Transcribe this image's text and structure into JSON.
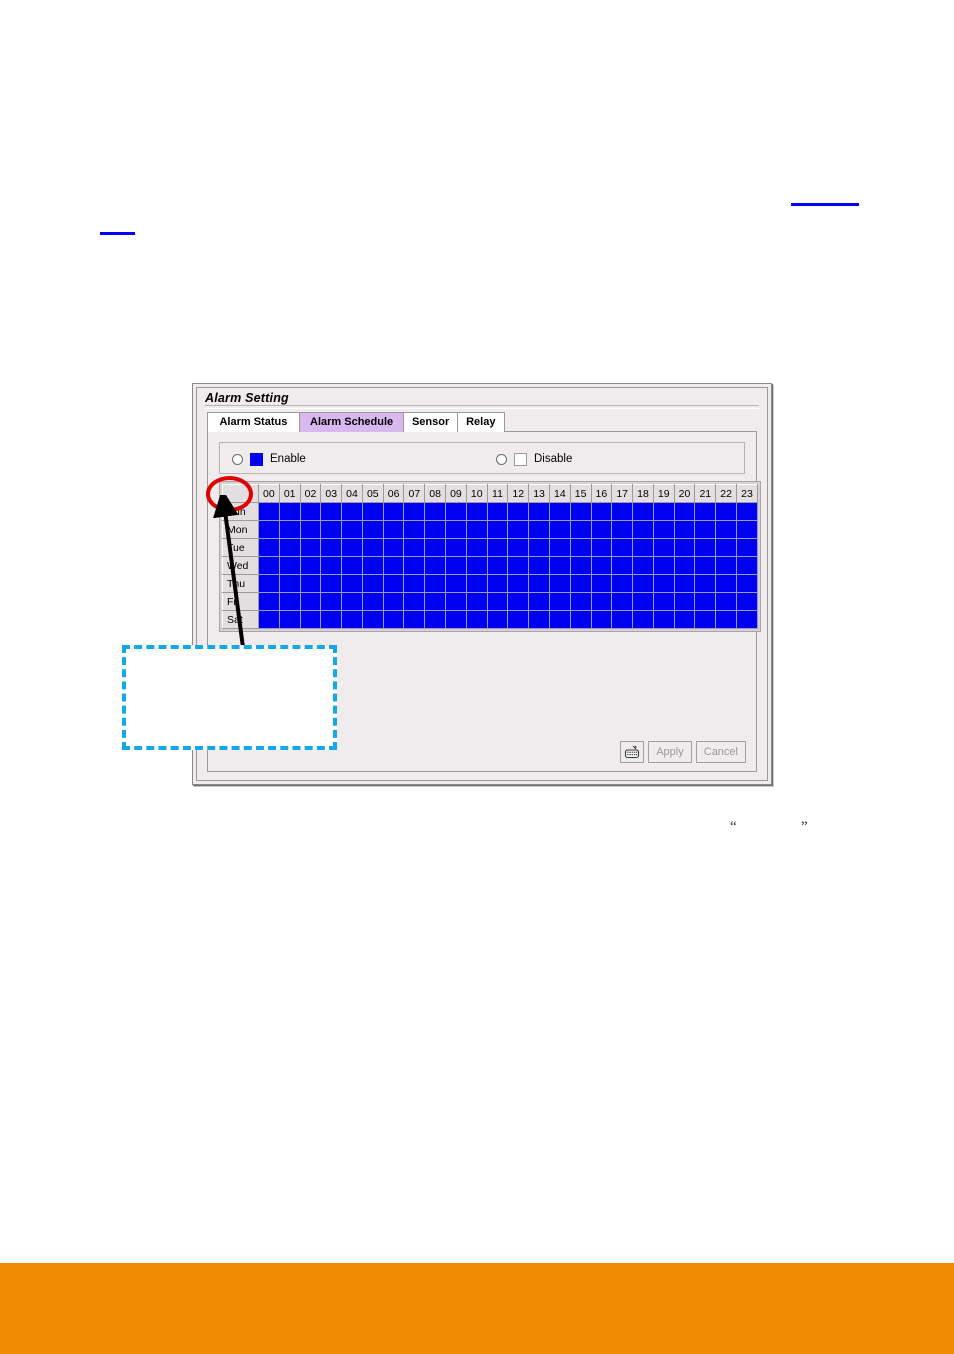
{
  "page": {
    "footer_band_color": "#f08a00",
    "link_rule_color": "#0000ff",
    "quote_open": "“",
    "quote_close": "”"
  },
  "dialog": {
    "title": "Alarm Setting",
    "tabs": [
      {
        "label": "Alarm Status",
        "selected": false
      },
      {
        "label": "Alarm Schedule",
        "selected": true
      },
      {
        "label": "Sensor",
        "selected": false
      },
      {
        "label": "Relay",
        "selected": false
      }
    ],
    "mode": {
      "enable": {
        "label": "Enable",
        "swatch_color": "#0000f0",
        "checked": false
      },
      "disable": {
        "label": "Disable",
        "swatch_color": "#ffffff",
        "checked": false
      }
    },
    "schedule": {
      "corner_label": "",
      "hours": [
        "00",
        "01",
        "02",
        "03",
        "04",
        "05",
        "06",
        "07",
        "08",
        "09",
        "10",
        "11",
        "12",
        "13",
        "14",
        "15",
        "16",
        "17",
        "18",
        "19",
        "20",
        "21",
        "22",
        "23"
      ],
      "days": [
        "Sun",
        "Mon",
        "Tue",
        "Wed",
        "Thu",
        "Fri",
        "Sat"
      ],
      "active_color": "#0000f0",
      "selected_cells": {
        "Sun": [
          0,
          1,
          2,
          3,
          4,
          5,
          6,
          7,
          8,
          9,
          10,
          11,
          12,
          13,
          14,
          15,
          16,
          17,
          18,
          19,
          20,
          21,
          22,
          23
        ],
        "Mon": [
          0,
          1,
          2,
          3,
          4,
          5,
          6,
          7,
          8,
          9,
          10,
          11,
          12,
          13,
          14,
          15,
          16,
          17,
          18,
          19,
          20,
          21,
          22,
          23
        ],
        "Tue": [
          0,
          1,
          2,
          3,
          4,
          5,
          6,
          7,
          8,
          9,
          10,
          11,
          12,
          13,
          14,
          15,
          16,
          17,
          18,
          19,
          20,
          21,
          22,
          23
        ],
        "Wed": [
          0,
          1,
          2,
          3,
          4,
          5,
          6,
          7,
          8,
          9,
          10,
          11,
          12,
          13,
          14,
          15,
          16,
          17,
          18,
          19,
          20,
          21,
          22,
          23
        ],
        "Thu": [
          0,
          1,
          2,
          3,
          4,
          5,
          6,
          7,
          8,
          9,
          10,
          11,
          12,
          13,
          14,
          15,
          16,
          17,
          18,
          19,
          20,
          21,
          22,
          23
        ],
        "Fri": [
          0,
          1,
          2,
          3,
          4,
          5,
          6,
          7,
          8,
          9,
          10,
          11,
          12,
          13,
          14,
          15,
          16,
          17,
          18,
          19,
          20,
          21,
          22,
          23
        ],
        "Sat": [
          0,
          1,
          2,
          3,
          4,
          5,
          6,
          7,
          8,
          9,
          10,
          11,
          12,
          13,
          14,
          15,
          16,
          17,
          18,
          19,
          20,
          21,
          22,
          23
        ]
      }
    },
    "footer": {
      "keypad_icon": "keyboard-icon",
      "apply_label": "Apply",
      "cancel_label": "Cancel",
      "apply_enabled": false,
      "cancel_enabled": false
    }
  },
  "annotations": {
    "ellipse_color": "#e00000",
    "arrow_color": "#000000",
    "callout_border_color": "#14a8e8",
    "callout_text": ""
  }
}
